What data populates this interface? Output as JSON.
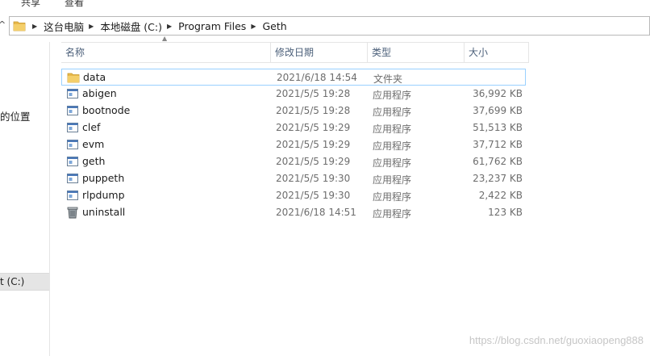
{
  "ribbon": {
    "tabs": [
      "共享",
      "查看"
    ]
  },
  "address": {
    "crumbs": [
      "这台电脑",
      "本地磁盘 (C:)",
      "Program Files",
      "Geth"
    ]
  },
  "nav": {
    "location_text": "的位置",
    "drive_text": "t (C:)"
  },
  "columns": {
    "name": "名称",
    "date": "修改日期",
    "type": "类型",
    "size": "大小"
  },
  "files": [
    {
      "name": "data",
      "date": "2021/6/18 14:54",
      "type": "文件夹",
      "size": "",
      "icon": "folder-icon"
    },
    {
      "name": "abigen",
      "date": "2021/5/5 19:28",
      "type": "应用程序",
      "size": "36,992 KB",
      "icon": "app-icon"
    },
    {
      "name": "bootnode",
      "date": "2021/5/5 19:28",
      "type": "应用程序",
      "size": "37,699 KB",
      "icon": "app-icon"
    },
    {
      "name": "clef",
      "date": "2021/5/5 19:29",
      "type": "应用程序",
      "size": "51,513 KB",
      "icon": "app-icon"
    },
    {
      "name": "evm",
      "date": "2021/5/5 19:29",
      "type": "应用程序",
      "size": "37,712 KB",
      "icon": "app-icon"
    },
    {
      "name": "geth",
      "date": "2021/5/5 19:29",
      "type": "应用程序",
      "size": "61,762 KB",
      "icon": "app-icon"
    },
    {
      "name": "puppeth",
      "date": "2021/5/5 19:30",
      "type": "应用程序",
      "size": "23,237 KB",
      "icon": "app-icon"
    },
    {
      "name": "rlpdump",
      "date": "2021/5/5 19:30",
      "type": "应用程序",
      "size": "2,422 KB",
      "icon": "app-icon"
    },
    {
      "name": "uninstall",
      "date": "2021/6/18 14:51",
      "type": "应用程序",
      "size": "123 KB",
      "icon": "uninstall-icon"
    }
  ],
  "selected_index": 0,
  "watermark": "https://blog.csdn.net/guoxiaopeng888",
  "colors": {
    "folder": "#e8b84a",
    "selection_border": "#99d1ff",
    "header_text": "#4c607a"
  }
}
